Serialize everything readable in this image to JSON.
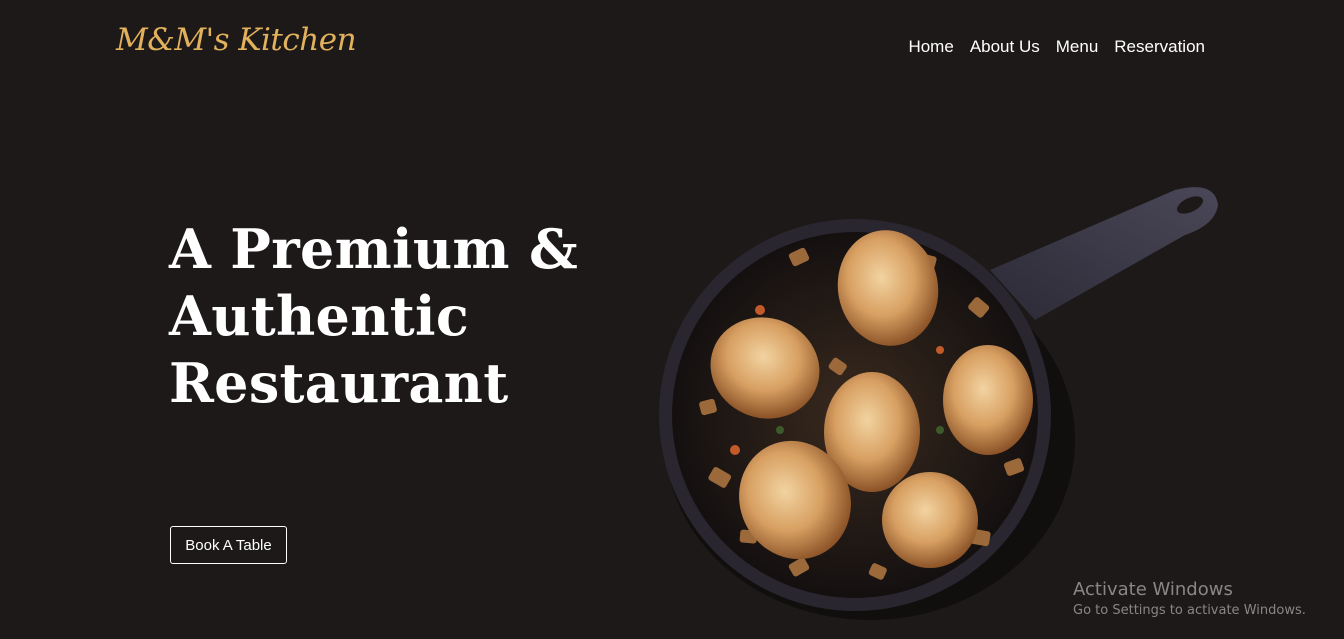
{
  "header": {
    "logo_text": "M&M's Kitchen",
    "nav": [
      "Home",
      "About Us",
      "Menu",
      "Reservation"
    ]
  },
  "hero": {
    "title_lines": [
      "A Premium &",
      "Authentic",
      "Restaurant"
    ],
    "cta_label": "Book A Table",
    "image": "skillet-roasted-chicken-with-stuffing"
  },
  "watermark": {
    "title": "Activate Windows",
    "subtitle": "Go to Settings to activate Windows."
  },
  "colors": {
    "background": "#1c1918",
    "logo": "#e2b15c",
    "text": "#ffffff"
  }
}
